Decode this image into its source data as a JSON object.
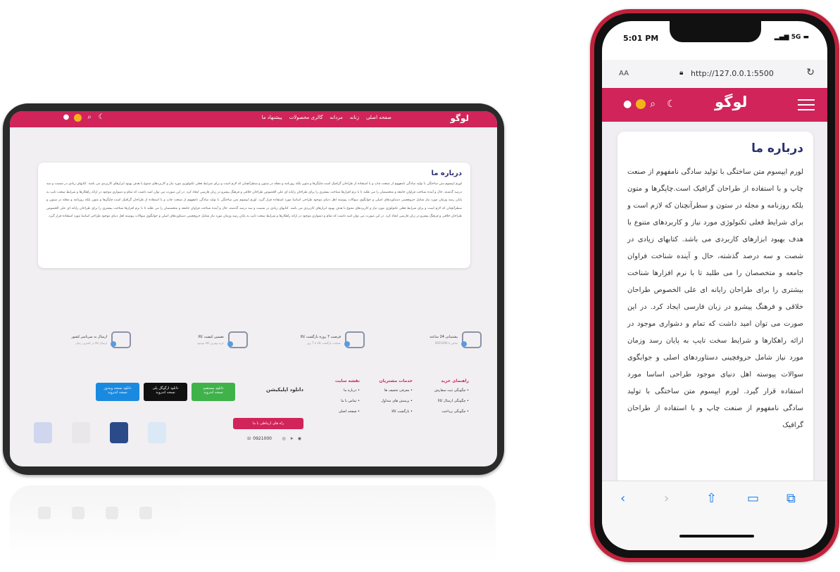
{
  "colors": {
    "accent": "#d0245a",
    "link": "#1a7cf0",
    "phone_frame": "#c0223c"
  },
  "tablet": {
    "logo": "لوگو",
    "menu": [
      "صفحه اصلی",
      "زنانه",
      "مردانه",
      "گالری محصولات",
      "پیشنهاد ما"
    ],
    "icons": [
      "user-icon",
      "bell-icon",
      "search-icon",
      "moon-icon"
    ],
    "about_title": "درباره ما",
    "about_text": "لورم ایپسوم متن ساختگی با تولید سادگی نامفهوم از صنعت چاپ و با استفاده از طراحان گرافیک است.چاپگرها و متون بلکه روزنامه و مجله در ستون و سطرآنچنان که لازم است و برای شرایط فعلی تکنولوژی مورد نیاز و کاربردهای متنوع با هدف بهبود ابزارهای کاربردی می باشد. کتابهای زیادی در شصت و سه درصد گذشته، حال و آینده شناخت فراوان جامعه و متخصصان را می طلبد تا با نرم افزارها شناخت بیشتری را برای طراحان رایانه ای علی الخصوص طراحان خلاقی و فرهنگ پیشرو در زبان فارسی ایجاد کرد. در این صورت می توان امید داشت که تمام و دشواری موجود در ارائه راهکارها و شرایط سخت تایپ به پایان رسد وزمان مورد نیاز شامل حروفچینی دستاوردهای اصلی و جوابگوی سوالات پیوسته اهل دنیای موجود طراحی اساسا مورد استفاده قرار گیرد. لورم ایپسوم متن ساختگی با تولید سادگی نامفهوم از صنعت چاپ و با استفاده از طراحان گرافیک است.چاپگرها و متون بلکه روزنامه و مجله در ستون و سطرآنچنان که لازم است و برای شرایط فعلی تکنولوژی مورد نیاز و کاربردهای متنوع با هدف بهبود ابزارهای کاربردی می باشد. کتابهای زیادی در شصت و سه درصد گذشته، حال و آینده شناخت فراوان جامعه و متخصصان را می طلبد تا با نرم افزارها شناخت بیشتری را برای طراحان رایانه ای علی الخصوص طراحان خلاقی و فرهنگ پیشرو در زبان فارسی ایجاد کرد. در این صورت می توان امید داشت که تمام و دشواری موجود در ارائه راهکارها و شرایط سخت تایپ به پایان رسد وزمان مورد نیاز شامل حروفچینی دستاوردهای اصلی و جوابگوی سوالات پیوسته اهل دنیای موجود طراحی اساسا مورد استفاده قرار گیرد.",
    "features": [
      {
        "title": "پشتیبانی 24 ساعته",
        "sub": "تماس با 0921000"
      },
      {
        "title": "فرصت 7 روزه بازگشت کالا",
        "sub": "ضمانت بازگشت کالا تا 7 روز"
      },
      {
        "title": "تضمین کیفیت کالا",
        "sub": "خرید بهترین کالا موجود"
      },
      {
        "title": "ارسال به سرتاسر کشور",
        "sub": "ارسال کالا در کمترین زمان"
      }
    ],
    "footer_cols": [
      {
        "title": "راهنمای خرید",
        "items": [
          "• چگونگی ثبت سفارش",
          "• چگونگی ارسال کالا",
          "• چگونگی پرداخت"
        ]
      },
      {
        "title": "خدمات مشتریان",
        "items": [
          "• معرفی تخفیف ها",
          "• پرسش های متداول",
          "• بازگشت کالا"
        ]
      },
      {
        "title": "نقشه سایت",
        "items": [
          "• درباره ما",
          "• تماس با ما",
          "• صفحه اصلی"
        ]
      }
    ],
    "download_title": "دانلود اپلیکیشن",
    "downloads": [
      {
        "label": "دانلود مستقیم",
        "sub": "نسخه اندروید"
      },
      {
        "label": "دانلود ازگوگل پلی",
        "sub": "نسخه اندروید"
      },
      {
        "label": "دانلود نسخه ویندوز",
        "sub": "نسخه اندروید"
      }
    ],
    "contact_button": "راه های ارتباطی با ما",
    "phone": "0921000"
  },
  "phone": {
    "time": "5:01 PM",
    "signal": "5G",
    "aa": "AA",
    "url": "http://127.0.0.1:5500",
    "logo": "لوگو",
    "about_title": "درباره ما",
    "about_text": "لورم ایپسوم متن ساختگی با تولید سادگی نامفهوم از صنعت چاپ و با استفاده از طراحان گرافیک است.چاپگرها و متون بلکه روزنامه و مجله در ستون و سطرآنچنان که لازم است و برای شرایط فعلی تکنولوژی مورد نیاز و کاربردهای متنوع با هدف بهبود ابزارهای کاربردی می باشد. کتابهای زیادی در شصت و سه درصد گذشته، حال و آینده شناخت فراوان جامعه و متخصصان را می طلبد تا با نرم افزارها شناخت بیشتری را برای طراحان رایانه ای علی الخصوص طراحان خلاقی و فرهنگ پیشرو در زبان فارسی ایجاد کرد. در این صورت می توان امید داشت که تمام و دشواری موجود در ارائه راهکارها و شرایط سخت تایپ به پایان رسد وزمان مورد نیاز شامل حروفچینی دستاوردهای اصلی و جوابگوی سوالات پیوسته اهل دنیای موجود طراحی اساسا مورد استفاده قرار گیرد. لورم ایپسوم متن ساختگی با تولید سادگی نامفهوم از صنعت چاپ و با استفاده از طراحان گرافیک"
  }
}
